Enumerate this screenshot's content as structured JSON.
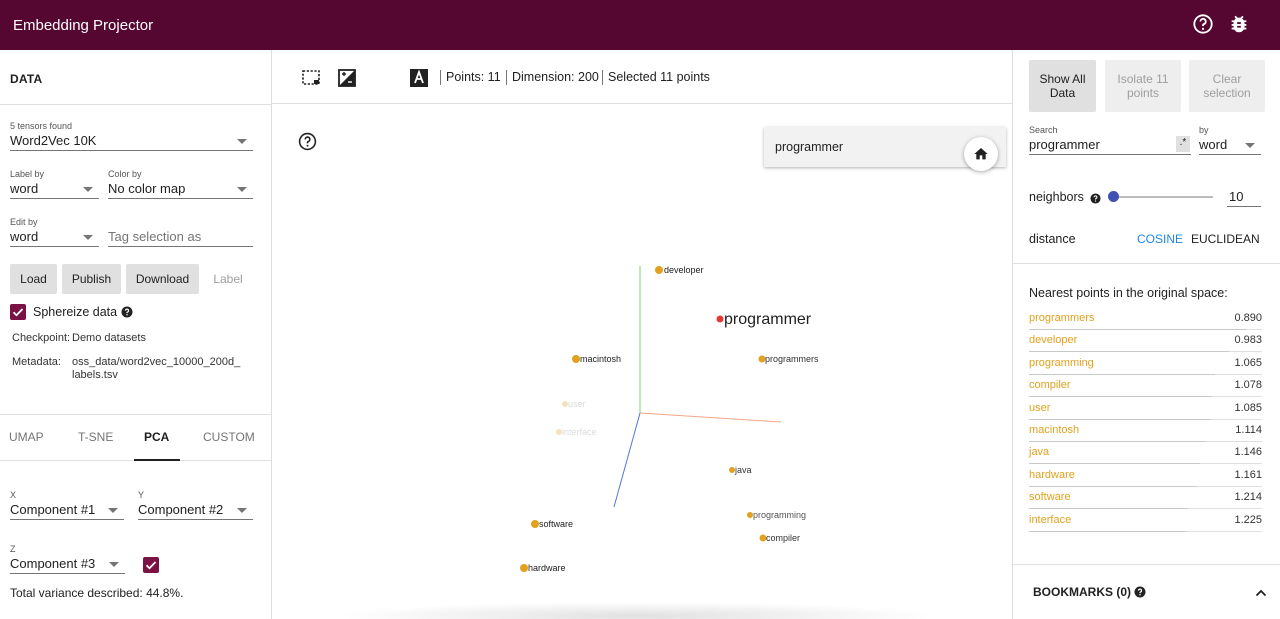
{
  "app": {
    "title": "Embedding Projector"
  },
  "data_panel": {
    "title": "DATA",
    "tensor_count_label": "5 tensors found",
    "tensor_value": "Word2Vec 10K",
    "label_by_label": "Label by",
    "label_by_value": "word",
    "color_by_label": "Color by",
    "color_by_value": "No color map",
    "edit_by_label": "Edit by",
    "edit_by_value": "word",
    "tag_placeholder": "Tag selection as",
    "buttons": {
      "load": "Load",
      "publish": "Publish",
      "download": "Download",
      "label": "Label"
    },
    "sphereize_label": "Sphereize data",
    "checkpoint_label": "Checkpoint:",
    "checkpoint_value": "Demo datasets",
    "metadata_label": "Metadata:",
    "metadata_value_line1": "oss_data/word2vec_10000_200d_",
    "metadata_value_line2": "labels.tsv"
  },
  "projection_tabs": [
    "UMAP",
    "T-SNE",
    "PCA",
    "CUSTOM"
  ],
  "pca": {
    "x_label": "X",
    "x_value": "Component #1",
    "y_label": "Y",
    "y_value": "Component #2",
    "z_label": "Z",
    "z_value": "Component #3",
    "variance": "Total variance described: 44.8%."
  },
  "toolbar": {
    "points": "Points: 11",
    "dimension": "Dimension: 200",
    "selected": "Selected 11 points"
  },
  "selected_word": "programmer",
  "plot": {
    "center_label": "programmer",
    "labels": {
      "developer": "developer",
      "macintosh": "macintosh",
      "programmers": "programmers",
      "java": "java",
      "programming": "programming",
      "software": "software",
      "compiler": "compiler",
      "hardware": "hardware",
      "user": "user",
      "interface": "interface"
    }
  },
  "inspector": {
    "show_all": "Show All Data",
    "isolate": "Isolate 11 points",
    "clear": "Clear selection",
    "search_label": "Search",
    "search_value": "programmer",
    "regex": ".*",
    "by_label": "by",
    "by_value": "word",
    "neighbors_label": "neighbors",
    "neighbors_value": "10",
    "neighbors_fraction": 0.0,
    "distance_label": "distance",
    "cosine": "COSINE",
    "euclidean": "EUCLIDEAN",
    "nearest_title": "Nearest points in the original space:",
    "nearest": [
      {
        "word": "programmers",
        "dist": "0.890"
      },
      {
        "word": "developer",
        "dist": "0.983"
      },
      {
        "word": "programming",
        "dist": "1.065"
      },
      {
        "word": "compiler",
        "dist": "1.078"
      },
      {
        "word": "user",
        "dist": "1.085"
      },
      {
        "word": "macintosh",
        "dist": "1.114"
      },
      {
        "word": "java",
        "dist": "1.146"
      },
      {
        "word": "hardware",
        "dist": "1.161"
      },
      {
        "word": "software",
        "dist": "1.214"
      },
      {
        "word": "interface",
        "dist": "1.225"
      }
    ],
    "bookmarks": "BOOKMARKS (0)"
  },
  "colors": {
    "brand": "#560731",
    "accent": "#7b1245",
    "point": "#e2a11f",
    "selected": "#e53935",
    "link": "#1e88e5"
  }
}
